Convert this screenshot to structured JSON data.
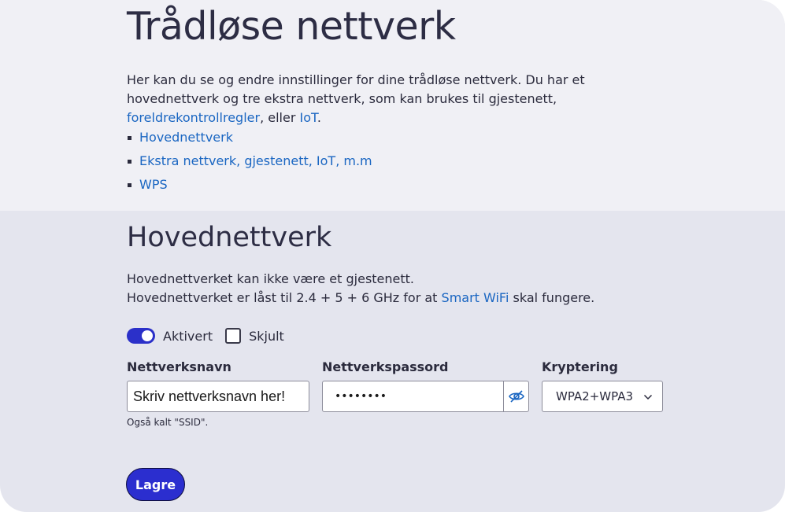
{
  "page": {
    "title": "Trådløse nettverk",
    "intro": {
      "text1": "Her kan du se og endre innstillinger for dine trådløse nettverk. Du har et hovednettverk og tre ekstra nettverk, som kan brukes til gjestenett, ",
      "link1": "foreldrekontrollregler",
      "text2": ", eller ",
      "link2": "IoT",
      "text3": "."
    },
    "toc": [
      {
        "label": "Hovednettverk"
      },
      {
        "label": "Ekstra nettverk, gjestenett, IoT, m.m"
      },
      {
        "label": "WPS"
      }
    ]
  },
  "main_network": {
    "heading": "Hovednettverk",
    "desc_line1": "Hovednettverket kan ikke være et gjestenett.",
    "desc_line2_pre": "Hovednettverket er låst til 2.4 + 5 + 6 GHz for at ",
    "desc_line2_link": "Smart WiFi",
    "desc_line2_post": " skal fungere.",
    "enabled_label": "Aktivert",
    "enabled": true,
    "hidden_label": "Skjult",
    "hidden": false,
    "ssid_label": "Nettverksnavn",
    "ssid_value": "Skriv nettverksnavn her!",
    "ssid_hint": "Også kalt \"SSID\".",
    "password_label": "Nettverkspassord",
    "password_value": "••••••••",
    "encryption_label": "Kryptering",
    "encryption_value": "WPA2+WPA3",
    "save_label": "Lagre"
  },
  "colors": {
    "accent": "#2b2ecf",
    "link": "#1a66c2",
    "top_bg": "#f0f0f5",
    "section_bg": "#e4e5ee"
  },
  "icons": {
    "password_toggle": "eye-off-icon",
    "encryption_dropdown": "chevron-down-icon"
  }
}
